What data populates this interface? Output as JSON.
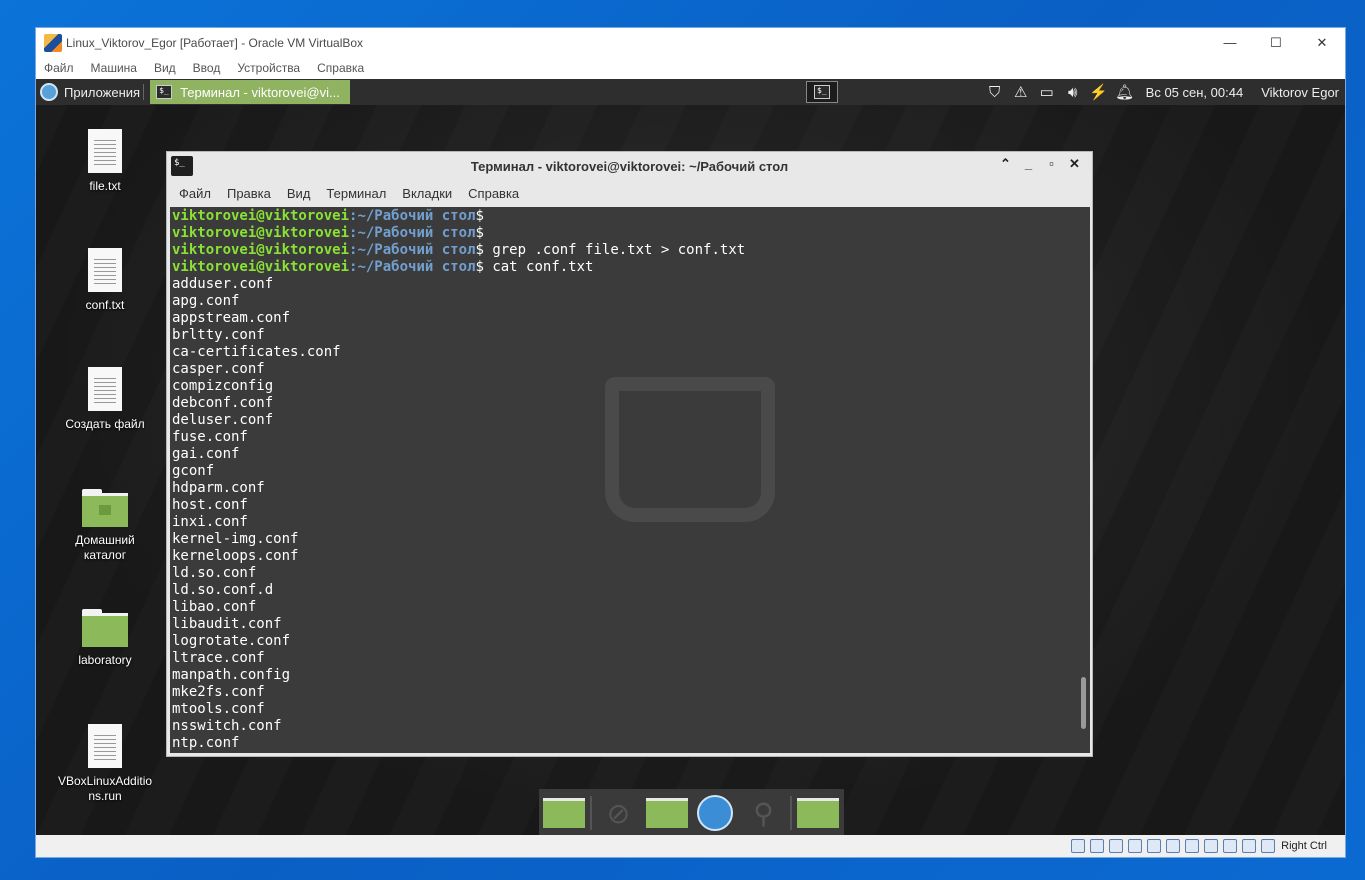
{
  "vbox": {
    "title": "Linux_Viktorov_Egor [Работает] - Oracle VM VirtualBox",
    "menu": [
      "Файл",
      "Машина",
      "Вид",
      "Ввод",
      "Устройства",
      "Справка"
    ],
    "minimize": "—",
    "maximize": "☐",
    "close": "✕",
    "host_key": "Right Ctrl"
  },
  "panel": {
    "menu_label": "Приложения",
    "active_task": "Терминал - viktorovei@vi...",
    "clock": "Вс 05 сен, 00:44",
    "user": "Viktorov Egor"
  },
  "desktop_icons": [
    {
      "label": "file.txt"
    },
    {
      "label": "conf.txt"
    },
    {
      "label": "Создать файл"
    },
    {
      "label": "Домашний каталог"
    },
    {
      "label": "laboratory"
    },
    {
      "label": "VBoxLinuxAdditions.run"
    }
  ],
  "terminal": {
    "title": "Терминал - viktorovei@viktorovei: ~/Рабочий стол",
    "menu": [
      "Файл",
      "Правка",
      "Вид",
      "Терминал",
      "Вкладки",
      "Справка"
    ],
    "prompt_user": "viktorovei@viktorovei",
    "prompt_path": ":~/Рабочий стол",
    "commands": [
      "",
      "",
      " grep .conf file.txt > conf.txt",
      " cat conf.txt"
    ],
    "output": [
      "adduser.conf",
      "apg.conf",
      "appstream.conf",
      "brltty.conf",
      "ca-certificates.conf",
      "casper.conf",
      "compizconfig",
      "debconf.conf",
      "deluser.conf",
      "fuse.conf",
      "gai.conf",
      "gconf",
      "hdparm.conf",
      "host.conf",
      "inxi.conf",
      "kernel-img.conf",
      "kerneloops.conf",
      "ld.so.conf",
      "ld.so.conf.d",
      "libao.conf",
      "libaudit.conf",
      "logrotate.conf",
      "ltrace.conf",
      "manpath.config",
      "mke2fs.conf",
      "mtools.conf",
      "nsswitch.conf",
      "ntp.conf"
    ]
  }
}
